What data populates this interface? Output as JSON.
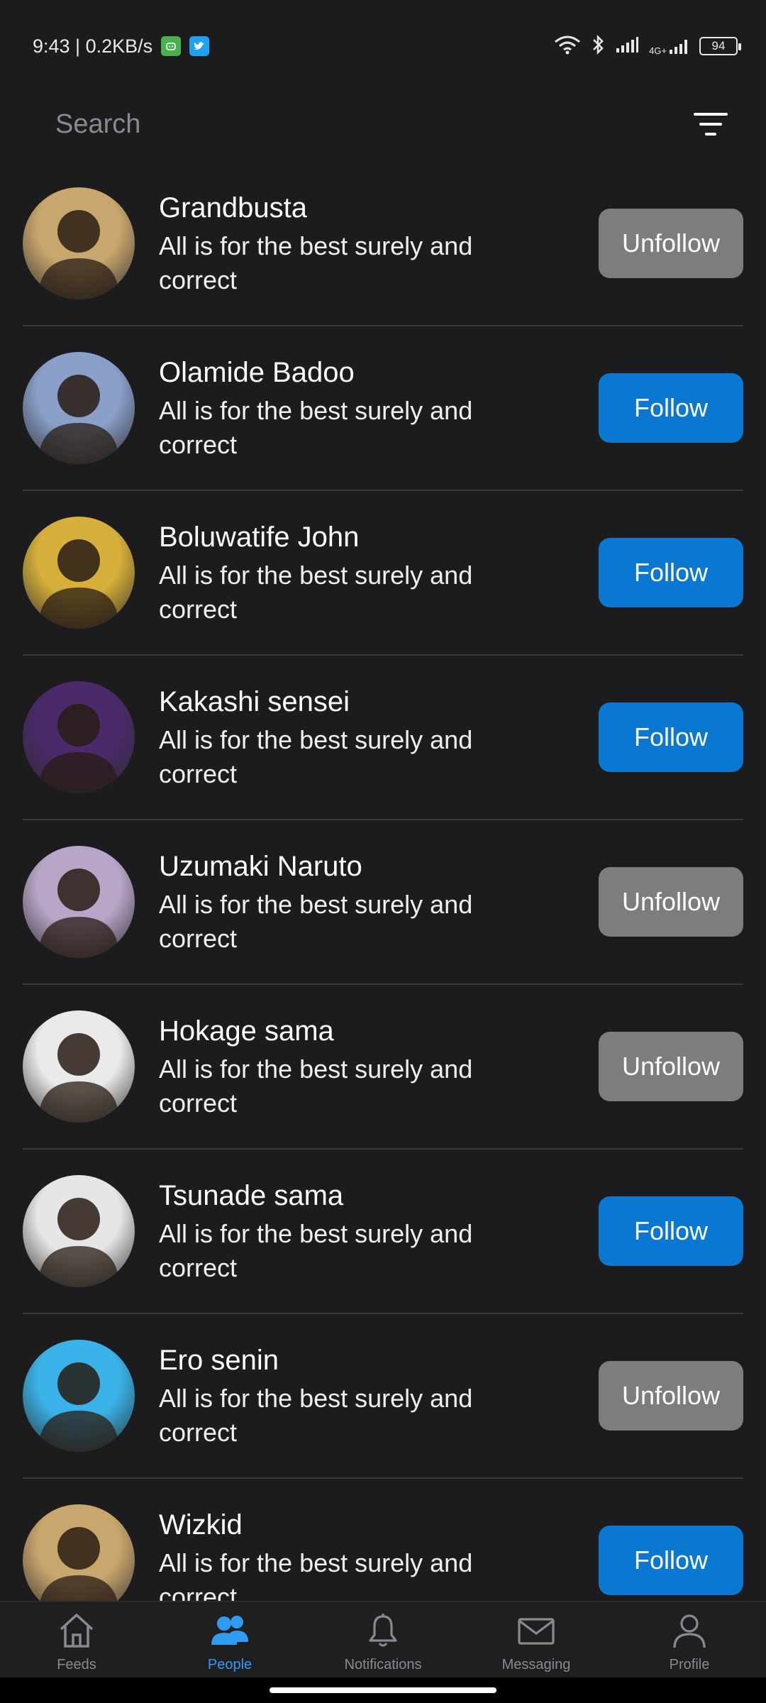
{
  "status_bar": {
    "time_speed": "9:43 | 0.2KB/s",
    "network": "4G+",
    "battery": "94"
  },
  "search": {
    "placeholder": "Search"
  },
  "people": [
    {
      "name": "Grandbusta",
      "bio": "All is for the best surely and correct",
      "action": "Unfollow",
      "following": true,
      "avatar_color": "#c8a66d"
    },
    {
      "name": "Olamide Badoo",
      "bio": "All is for the best surely and correct",
      "action": "Follow",
      "following": false,
      "avatar_color": "#8aa0c8"
    },
    {
      "name": "Boluwatife John",
      "bio": "All is for the best surely and correct",
      "action": "Follow",
      "following": false,
      "avatar_color": "#d6b03a"
    },
    {
      "name": "Kakashi sensei",
      "bio": "All is for the best surely and correct",
      "action": "Follow",
      "following": false,
      "avatar_color": "#4a2a6a"
    },
    {
      "name": "Uzumaki Naruto",
      "bio": "All is for the best surely and correct",
      "action": "Unfollow",
      "following": true,
      "avatar_color": "#b8a6c8"
    },
    {
      "name": "Hokage sama",
      "bio": "All is for the best surely and correct",
      "action": "Unfollow",
      "following": true,
      "avatar_color": "#eaeaea"
    },
    {
      "name": "Tsunade sama",
      "bio": "All is for the best surely and correct",
      "action": "Follow",
      "following": false,
      "avatar_color": "#e6e6e6"
    },
    {
      "name": "Ero senin",
      "bio": "All is for the best surely and correct",
      "action": "Unfollow",
      "following": true,
      "avatar_color": "#39b3e8"
    },
    {
      "name": "Wizkid",
      "bio": "All is for the best surely and correct",
      "action": "Follow",
      "following": false,
      "avatar_color": "#c8a66d"
    }
  ],
  "nav": {
    "feeds": "Feeds",
    "people": "People",
    "notifications": "Notifications",
    "messaging": "Messaging",
    "profile": "Profile"
  },
  "colors": {
    "background": "#1c1c1e",
    "follow": "#0a78d1",
    "unfollow": "#7d7d7d",
    "active_tab": "#2f9cf2"
  }
}
